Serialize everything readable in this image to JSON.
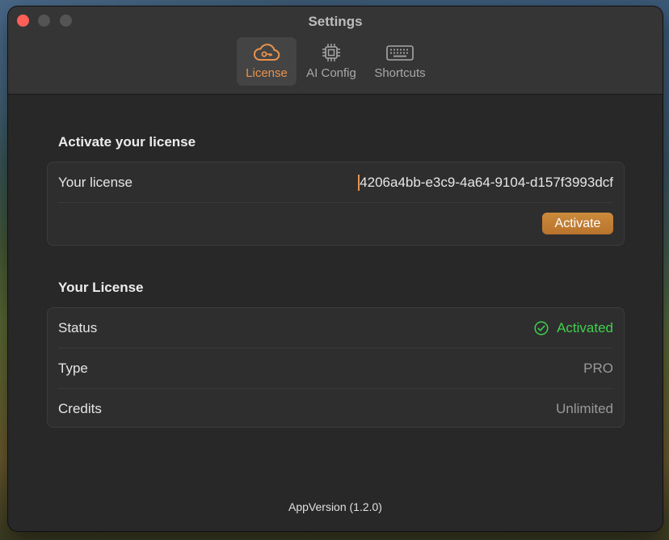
{
  "window": {
    "title": "Settings"
  },
  "tabs": [
    {
      "label": "License",
      "icon": "cloud-key-icon",
      "selected": true
    },
    {
      "label": "AI Config",
      "icon": "chip-icon",
      "selected": false
    },
    {
      "label": "Shortcuts",
      "icon": "keyboard-icon",
      "selected": false
    }
  ],
  "activate_section": {
    "title": "Activate your license",
    "license_label": "Your license",
    "license_value": "4206a4bb-e3c9-4a64-9104-d157f3993dcf",
    "activate_label": "Activate"
  },
  "license_section": {
    "title": "Your License",
    "rows": [
      {
        "label": "Status",
        "value": "Activated"
      },
      {
        "label": "Type",
        "value": "PRO"
      },
      {
        "label": "Credits",
        "value": "Unlimited"
      }
    ]
  },
  "footer": {
    "version": "AppVersion (1.2.0)"
  },
  "colors": {
    "accent": "#e8924e",
    "button": "#c0803a",
    "success": "#3ed14d"
  }
}
